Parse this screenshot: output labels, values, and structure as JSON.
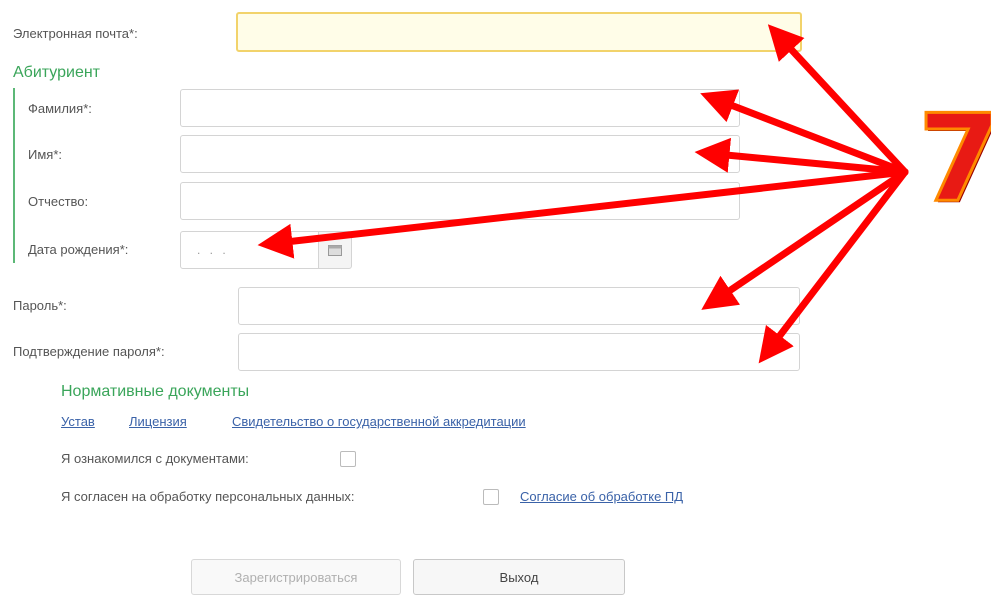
{
  "form": {
    "email": {
      "label": "Электронная почта*:",
      "value": ""
    },
    "applicant_section_title": "Абитуриент",
    "last_name": {
      "label": "Фамилия*:",
      "value": ""
    },
    "first_name": {
      "label": "Имя*:",
      "value": ""
    },
    "middle_name": {
      "label": "Отчество:",
      "value": ""
    },
    "birth_date": {
      "label": "Дата рождения*:",
      "placeholder": ". . ."
    },
    "password": {
      "label": "Пароль*:",
      "value": ""
    },
    "password_confirm": {
      "label": "Подтверждение пароля*:",
      "value": ""
    }
  },
  "documents": {
    "title": "Нормативные документы",
    "links": [
      "Устав",
      "Лицензия",
      "Свидетельство о государственной аккредитации"
    ],
    "acknowledge_label": "Я ознакомился с документами:",
    "consent_label": "Я согласен на обработку персональных данных:",
    "consent_link": "Согласие об обработке ПД"
  },
  "buttons": {
    "register": "Зарегистрироваться",
    "exit": "Выход"
  },
  "annotation": {
    "number": "7",
    "color": "#e81a14"
  }
}
